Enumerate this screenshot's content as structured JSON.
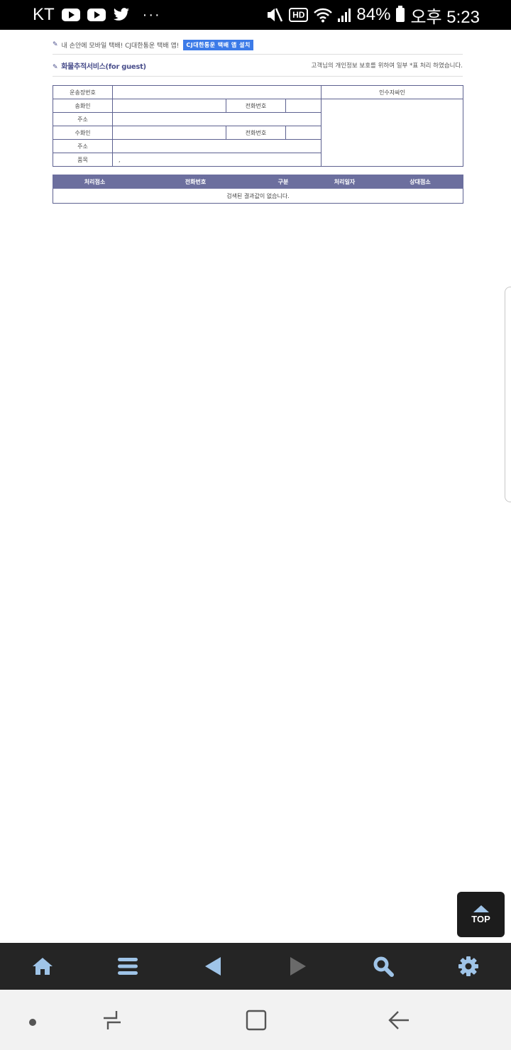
{
  "status_bar": {
    "carrier": "KT",
    "more": "···",
    "hd_badge": "HD",
    "battery_percent": "84%",
    "time": "오후 5:23"
  },
  "promo": {
    "text": "내 손안에 모바일 택배! CJ대한통운 택배 앱!",
    "button_label": "CJ대한통운 택배 앱 설치"
  },
  "section": {
    "title": "화물추적서비스(for guest)",
    "privacy_note": "고객님의 개인정보 보호를 위하여 일부 *표 처리 하였습니다."
  },
  "info_table": {
    "waybill_label": "운송장번호",
    "waybill_value": "",
    "sender_label": "송화인",
    "sender_value": "",
    "sender_phone_label": "전화번호",
    "sender_phone_value": "",
    "sender_address_label": "주소",
    "sender_address_value": "",
    "receiver_label": "수화인",
    "receiver_value": "",
    "receiver_phone_label": "전화번호",
    "receiver_phone_value": "",
    "receiver_address_label": "주소",
    "receiver_address_value": "",
    "item_label": "품목",
    "item_value": ",",
    "signature_label": "인수자싸인"
  },
  "history_table": {
    "columns": [
      "처리점소",
      "전화번호",
      "구분",
      "처리일자",
      "상대점소"
    ],
    "empty_message": "검색된 결과값이 없습니다."
  },
  "top_button": {
    "label": "TOP"
  },
  "toolbar": {
    "icons": [
      "home-icon",
      "menu-icon",
      "back-icon",
      "forward-icon",
      "search-icon",
      "settings-icon"
    ],
    "icon_color": "#9fc4e8",
    "disabled_color": "#6a6a6a"
  }
}
